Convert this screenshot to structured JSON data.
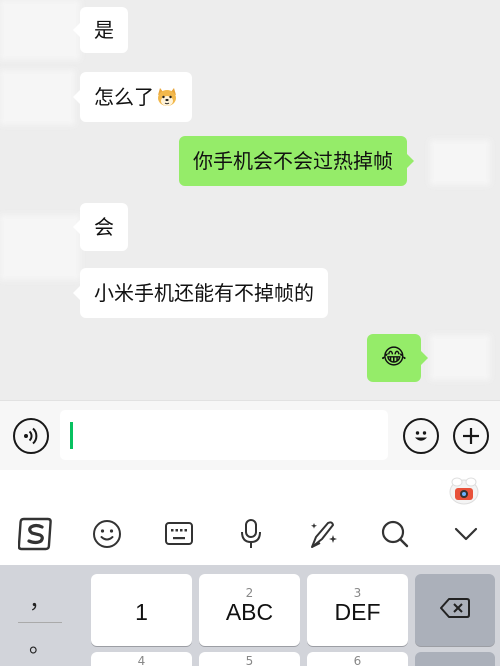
{
  "messages": [
    {
      "side": "left",
      "text": "是"
    },
    {
      "side": "left",
      "text": "怎么了",
      "emoji": "dog-face-emoji"
    },
    {
      "side": "right",
      "text": "你手机会不会过热掉帧"
    },
    {
      "side": "left",
      "text": "会"
    },
    {
      "side": "left",
      "text": "小米手机还能有不掉帧的"
    },
    {
      "side": "right",
      "text": "😂"
    }
  ],
  "input": {
    "value": ""
  },
  "icons": {
    "voice": "voice-icon",
    "emoji": "emoji-icon",
    "plus": "plus-icon",
    "mascot": "ime-mascot-icon",
    "logo": "sogou-logo-icon",
    "smile": "smiley-icon",
    "keyboard": "keyboard-icon",
    "mic": "microphone-icon",
    "magic": "magic-pen-icon",
    "search": "search-icon",
    "collapse": "chevron-down-icon",
    "backspace": "backspace-icon"
  },
  "keyboard": {
    "symbols": [
      "，",
      "。"
    ],
    "row1": [
      {
        "num": "",
        "label": "1"
      },
      {
        "num": "2",
        "label": "ABC"
      },
      {
        "num": "3",
        "label": "DEF"
      }
    ],
    "row2_nums": [
      "4",
      "5",
      "6"
    ]
  },
  "colors": {
    "chat_bg": "#ededed",
    "sent_bubble": "#95ec69",
    "received_bubble": "#ffffff",
    "caret": "#07c160",
    "keyboard_bg": "#d2d4da"
  }
}
